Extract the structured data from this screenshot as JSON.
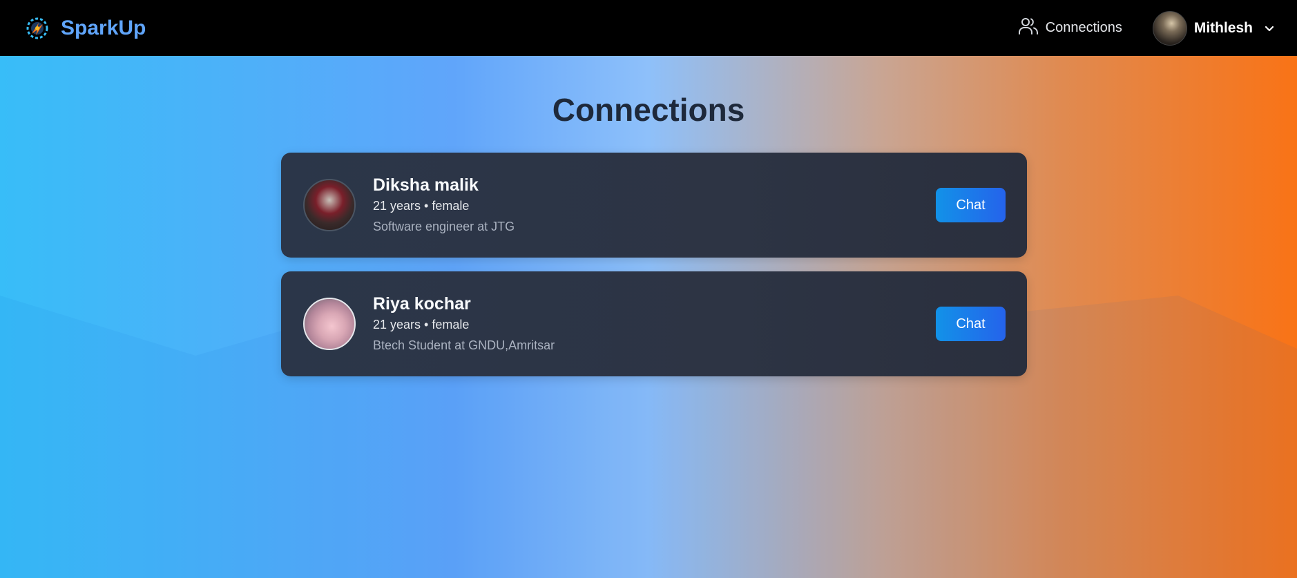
{
  "header": {
    "brand": "SparkUp",
    "nav_connections_label": "Connections",
    "user_name": "Mithlesh"
  },
  "main": {
    "title": "Connections",
    "connections": [
      {
        "name": "Diksha malik",
        "meta": "21 years • female",
        "about": "Software engineer at JTG",
        "chat_label": "Chat"
      },
      {
        "name": "Riya kochar",
        "meta": "21 years • female",
        "about": "Btech Student at GNDU,Amritsar",
        "chat_label": "Chat"
      }
    ]
  },
  "colors": {
    "brand": "#60a5fa",
    "navbar": "#000000",
    "card": "#2d3444",
    "button": "#1d7ee9",
    "gradient_left": "#38bdf8",
    "gradient_right": "#f97316"
  }
}
